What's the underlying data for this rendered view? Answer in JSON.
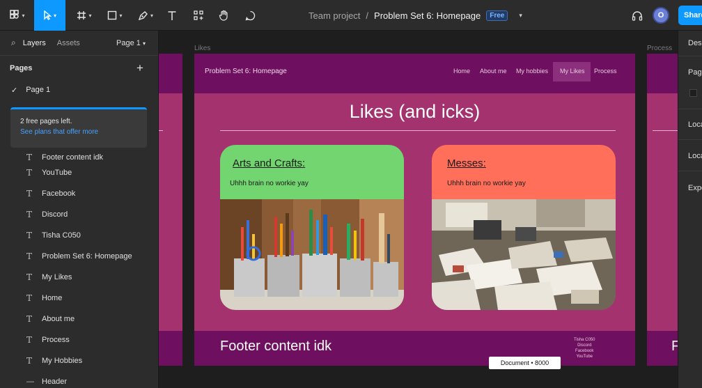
{
  "toolbar": {
    "file_name": "Problem Set 6: Homepage",
    "team_name": "Team project",
    "separator": "/",
    "plan_badge": "Free",
    "avatar_initial": "O",
    "share_label": "Share"
  },
  "left_panel": {
    "tabs": {
      "layers": "Layers",
      "assets": "Assets",
      "page_selector": "Page 1"
    },
    "pages_heading": "Pages",
    "add_icon": "+",
    "pages": [
      {
        "label": "Page 1",
        "selected": true
      }
    ],
    "upsell": {
      "message": "2 free pages left.",
      "link": "See plans that offer more"
    },
    "layers": [
      "Footer content idk",
      "YouTube",
      "Facebook",
      "Discord",
      "Tisha C050",
      "Problem Set 6: Homepage",
      "My Likes",
      "Home",
      "About me",
      "Process",
      "My Hobbies",
      "Header"
    ]
  },
  "canvas": {
    "frame_label_main": "Likes",
    "frame_label_right": "Process",
    "site_name": "Problem Set 6: Homepage",
    "nav": [
      "Home",
      "About me",
      "My hobbies",
      "My Likes",
      "Process"
    ],
    "nav_active": "My Likes",
    "heading": "Likes (and icks)",
    "cards": [
      {
        "title": "Arts and Crafts:",
        "subtitle": "Uhhh brain no workie yay",
        "color": "#72d56f",
        "image": "art-supplies-photo"
      },
      {
        "title": "Messes:",
        "subtitle": "Uhhh brain no workie yay",
        "color": "#ff6f5a",
        "image": "messy-desk-photo"
      }
    ],
    "footer_text": "Footer content idk",
    "footer_links": [
      "Tisha C050",
      "Discord",
      "Facebook",
      "YouTube"
    ],
    "right_frame_footer_initial": "F",
    "size_tag": "Document • 8000"
  },
  "right_panel": {
    "items": [
      "Design",
      "Page",
      "Local",
      "Local",
      "Export"
    ]
  },
  "colors": {
    "accent": "#0d99ff",
    "frame_dark": "#6e0f5f",
    "frame_body": "#a3326e"
  }
}
